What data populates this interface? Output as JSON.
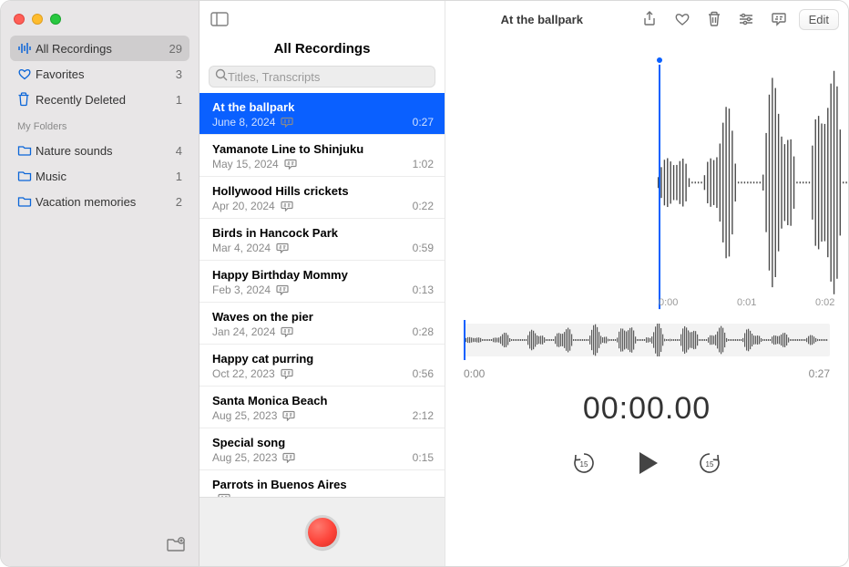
{
  "toolbar": {
    "title": "At the ballpark",
    "edit_label": "Edit"
  },
  "sidebar": {
    "smart": [
      {
        "icon": "waveform",
        "label": "All Recordings",
        "count": 29,
        "selected": true
      },
      {
        "icon": "heart",
        "label": "Favorites",
        "count": 3,
        "selected": false
      },
      {
        "icon": "trash",
        "label": "Recently Deleted",
        "count": 1,
        "selected": false
      }
    ],
    "section_label": "My Folders",
    "folders": [
      {
        "icon": "folder",
        "label": "Nature sounds",
        "count": 4
      },
      {
        "icon": "folder",
        "label": "Music",
        "count": 1
      },
      {
        "icon": "folder",
        "label": "Vacation memories",
        "count": 2
      }
    ]
  },
  "middle": {
    "title": "All Recordings",
    "search_placeholder": "Titles, Transcripts",
    "recordings": [
      {
        "title": "At the ballpark",
        "date": "June 8, 2024",
        "dur": "0:27",
        "selected": true,
        "has_transcript": false
      },
      {
        "title": "Yamanote Line to Shinjuku",
        "date": "May 15, 2024",
        "dur": "1:02",
        "selected": false,
        "has_transcript": false
      },
      {
        "title": "Hollywood Hills crickets",
        "date": "Apr 20, 2024",
        "dur": "0:22",
        "selected": false,
        "has_transcript": false
      },
      {
        "title": "Birds in Hancock Park",
        "date": "Mar 4, 2024",
        "dur": "0:59",
        "selected": false,
        "has_transcript": false
      },
      {
        "title": "Happy Birthday Mommy",
        "date": "Feb 3, 2024",
        "dur": "0:13",
        "selected": false,
        "has_transcript": true
      },
      {
        "title": "Waves on the pier",
        "date": "Jan 24, 2024",
        "dur": "0:28",
        "selected": false,
        "has_transcript": false
      },
      {
        "title": "Happy cat purring",
        "date": "Oct 22, 2023",
        "dur": "0:56",
        "selected": false,
        "has_transcript": false
      },
      {
        "title": "Santa Monica Beach",
        "date": "Aug 25, 2023",
        "dur": "2:12",
        "selected": false,
        "has_transcript": false
      },
      {
        "title": "Special song",
        "date": "Aug 25, 2023",
        "dur": "0:15",
        "selected": false,
        "has_transcript": true
      },
      {
        "title": "Parrots in Buenos Aires",
        "date": "",
        "dur": "",
        "selected": false,
        "has_transcript": false
      }
    ]
  },
  "detail": {
    "axis_labels": [
      "0:00",
      "0:01",
      "0:02"
    ],
    "mini_start": "0:00",
    "mini_end": "0:27",
    "timecode": "00:00.00"
  }
}
